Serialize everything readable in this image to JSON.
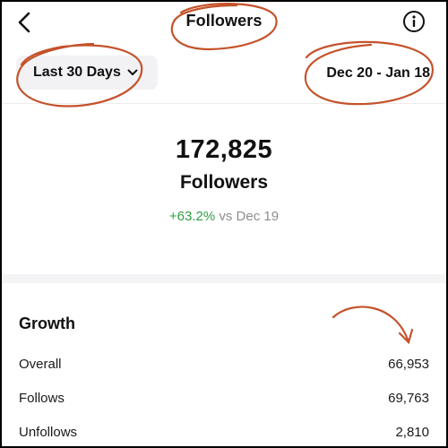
{
  "header": {
    "title": "Followers",
    "back_icon": "chevron-left-icon",
    "info_icon": "info-icon"
  },
  "range": {
    "selected": "Last 30 Days",
    "dates": "Dec 20 - Jan 18"
  },
  "summary": {
    "count": "172,825",
    "label": "Followers",
    "change": "+63.2%",
    "compare": "vs Dec 19"
  },
  "growth": {
    "title": "Growth",
    "rows": [
      {
        "label": "Overall",
        "value": "66,953"
      },
      {
        "label": "Follows",
        "value": "69,763"
      },
      {
        "label": "Unfollows",
        "value": "2,810"
      }
    ]
  },
  "colors": {
    "positive": "#2f9e44",
    "annotation": "#c4522a"
  }
}
